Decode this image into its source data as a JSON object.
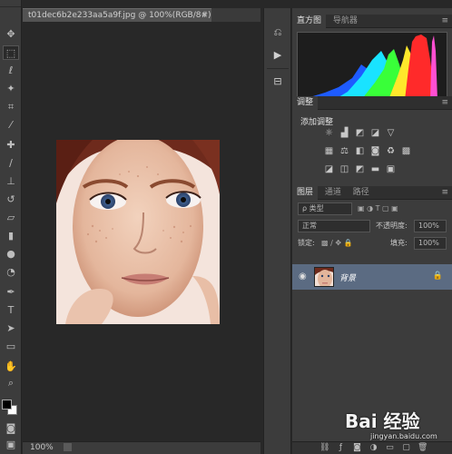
{
  "document": {
    "tab_title": "t01dec6b2e233aa5a9f.jpg @ 100%(RGB/8#)",
    "close_glyph": "×",
    "zoom": "100%"
  },
  "panels": {
    "histogram_tabs": [
      "直方图",
      "导航器"
    ],
    "adjustments_tab": "调整",
    "adjustments_title": "添加调整",
    "layers_tabs": [
      "图层",
      "通道",
      "路径"
    ],
    "filter_kind": "ρ 类型",
    "blend_mode": "正常",
    "opacity_label": "不透明度:",
    "opacity_value": "100%",
    "lock_label": "锁定:",
    "fill_label": "填充:",
    "fill_value": "100%",
    "layer_name": "背景"
  },
  "watermark": {
    "logo": "Bai 经验",
    "url": "jingyan.baidu.com"
  },
  "colors": {
    "foreground": "#000000",
    "background": "#ffffff",
    "selected_layer": "#5b6b82"
  }
}
